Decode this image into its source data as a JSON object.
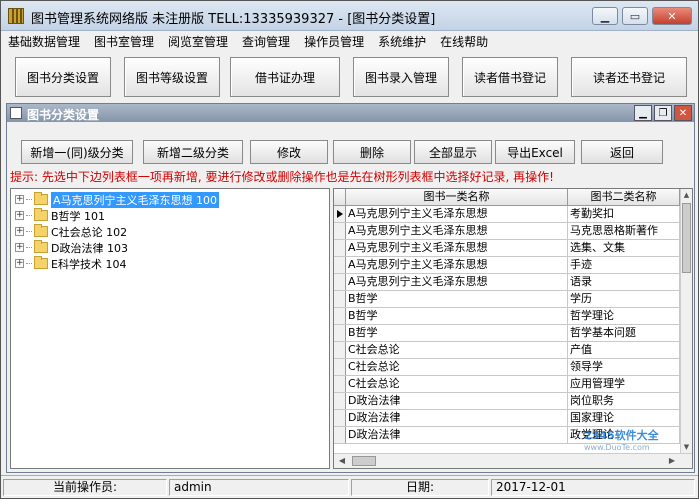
{
  "window": {
    "title": "图书管理系统网络版 未注册版 TELL:13335939327 - [图书分类设置]"
  },
  "menu": [
    "基础数据管理",
    "图书室管理",
    "阅览室管理",
    "查询管理",
    "操作员管理",
    "系统维护",
    "在线帮助"
  ],
  "toolbar": [
    "图书分类设置",
    "图书等级设置",
    "借书证办理",
    "图书录入管理",
    "读者借书登记",
    "读者还书登记"
  ],
  "mdi": {
    "title": "图书分类设置"
  },
  "actions": [
    "新增一(同)级分类",
    "新增二级分类",
    "修改",
    "删除",
    "全部显示",
    "导出Excel",
    "返回"
  ],
  "hint": "提示: 先选中下边列表框一项再新增, 要进行修改或删除操作也是先在树形列表框中选择好记录, 再操作!",
  "tree": [
    {
      "label": "A马克思列宁主义毛泽东思想 100",
      "selected": true
    },
    {
      "label": "B哲学 101"
    },
    {
      "label": "C社会总论 102"
    },
    {
      "label": "D政治法律 103"
    },
    {
      "label": "E科学技术 104"
    }
  ],
  "grid": {
    "columns": [
      "图书一类名称",
      "图书二类名称"
    ],
    "rows": [
      [
        "A马克思列宁主义毛泽东思想",
        "考勤奖扣"
      ],
      [
        "A马克思列宁主义毛泽东思想",
        "马克思恩格斯著作"
      ],
      [
        "A马克思列宁主义毛泽东思想",
        "选集、文集"
      ],
      [
        "A马克思列宁主义毛泽东思想",
        "手迹"
      ],
      [
        "A马克思列宁主义毛泽东思想",
        "语录"
      ],
      [
        "B哲学",
        "学历"
      ],
      [
        "B哲学",
        "哲学理论"
      ],
      [
        "B哲学",
        "哲学基本问题"
      ],
      [
        "C社会总论",
        "产值"
      ],
      [
        "C社会总论",
        "领导学"
      ],
      [
        "C社会总论",
        "应用管理学"
      ],
      [
        "D政治法律",
        "岗位职务"
      ],
      [
        "D政治法律",
        "国家理论"
      ],
      [
        "D政治法律",
        "政党理论"
      ]
    ]
  },
  "status": {
    "operator_label": "当前操作员:",
    "operator_value": "admin",
    "date_label": "日期:",
    "date_value": "2017-12-01"
  },
  "watermark": {
    "line1": "2345软件大全",
    "line2": "www.DuoTe.com"
  },
  "colors": {
    "hint": "#d40000",
    "selection": "#3399ff"
  }
}
